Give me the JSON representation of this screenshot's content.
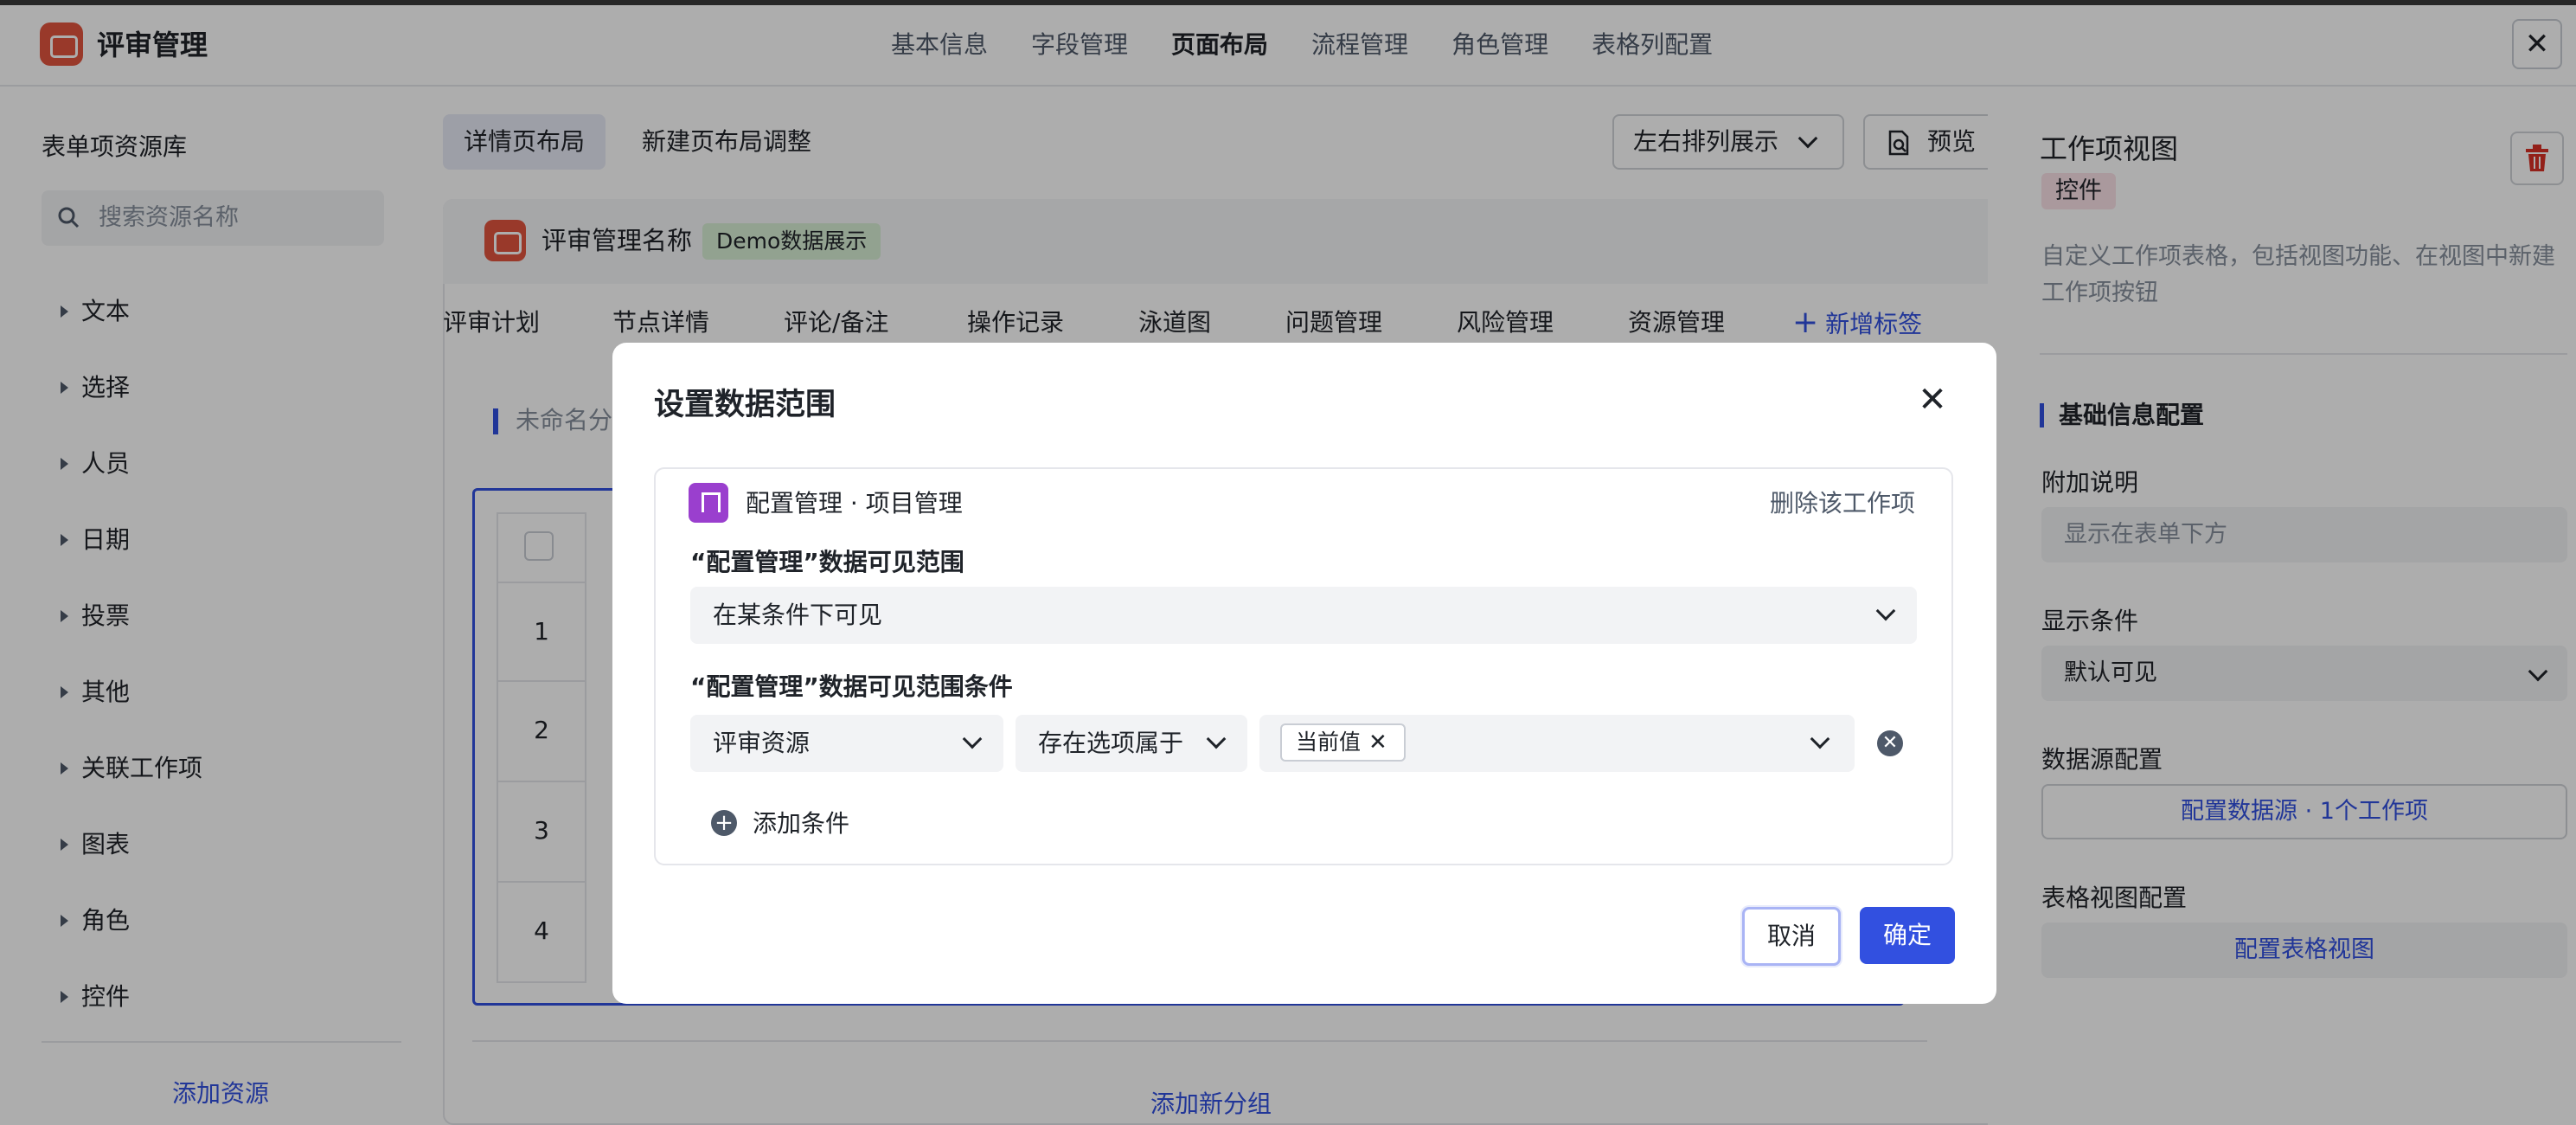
{
  "header": {
    "app_title": "评审管理",
    "nav_tabs": [
      "基本信息",
      "字段管理",
      "页面布局",
      "流程管理",
      "角色管理",
      "表格列配置"
    ],
    "close_label": "✕"
  },
  "left_panel": {
    "title": "表单项资源库",
    "search_placeholder": "搜索资源名称",
    "categories": [
      "文本",
      "选择",
      "人员",
      "日期",
      "投票",
      "其他",
      "关联工作项",
      "图表",
      "角色",
      "控件"
    ],
    "add_resource": "添加资源"
  },
  "center": {
    "subtabs": [
      "详情页布局",
      "新建页布局调整"
    ],
    "arrange_dropdown": "左右排列展示",
    "preview": "预览",
    "card_title": "评审管理名称",
    "demo_badge": "Demo数据展示",
    "content_tabs": [
      "评审计划",
      "节点详情",
      "评论/备注",
      "操作记录",
      "泳道图",
      "问题管理",
      "风险管理",
      "资源管理"
    ],
    "add_tag": "新增标签",
    "group_title": "未命名分",
    "row_numbers": [
      "1",
      "2",
      "3",
      "4"
    ],
    "add_group": "添加新分组"
  },
  "right_panel": {
    "title": "工作项视图",
    "badge": "控件",
    "description": "自定义工作项表格，包括视图功能、在视图中新建工作项按钮",
    "section_title": "基础信息配置",
    "extra_label": "附加说明",
    "extra_placeholder": "显示在表单下方",
    "condition_label": "显示条件",
    "condition_value": "默认可见",
    "datasource_label": "数据源配置",
    "datasource_link": "配置数据源 · 1个工作项",
    "tableview_label": "表格视图配置",
    "tableview_link": "配置表格视图"
  },
  "modal": {
    "title": "设置数据范围",
    "workitem_name": "配置管理 · 项目管理",
    "delete_workitem": "删除该工作项",
    "visible_range_label": "“配置管理”数据可见范围",
    "visible_range_value": "在某条件下可见",
    "condition_label": "“配置管理”数据可见范围条件",
    "cond_field": "评审资源",
    "cond_operator": "存在选项属于",
    "cond_tag": "当前值",
    "add_condition": "添加条件",
    "cancel": "取消",
    "confirm": "确定"
  },
  "colors": {
    "accent": "#3250e0",
    "brand_red": "#e2553f",
    "workitem_purple": "#9a3fce"
  }
}
